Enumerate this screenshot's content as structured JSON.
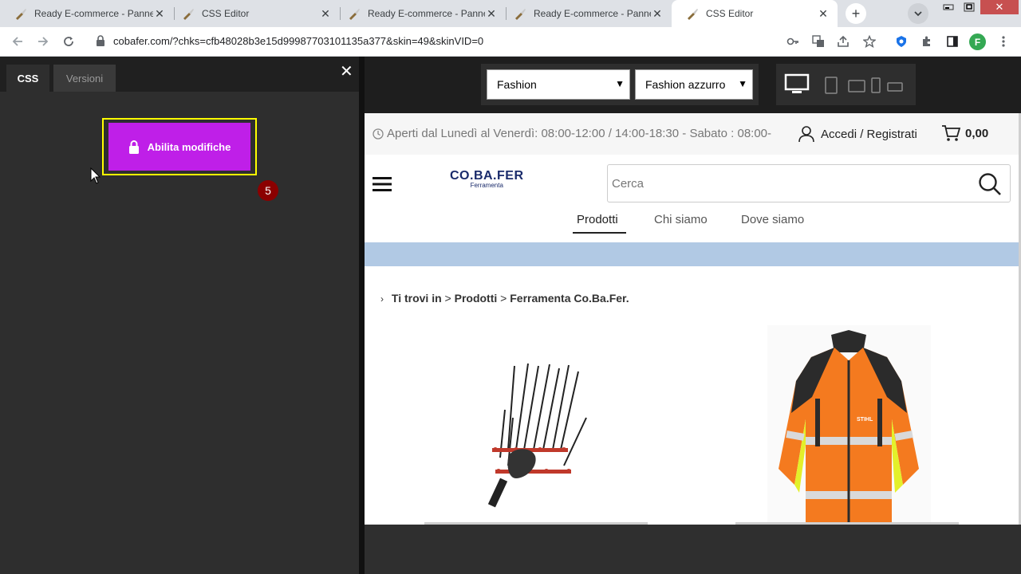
{
  "browser": {
    "tabs": [
      {
        "label": "Ready E-commerce - Pannello",
        "active": false
      },
      {
        "label": "CSS Editor",
        "active": false
      },
      {
        "label": "Ready E-commerce - Pannello",
        "active": false
      },
      {
        "label": "Ready E-commerce - Pannello",
        "active": false
      },
      {
        "label": "CSS Editor",
        "active": true
      }
    ],
    "url": "cobafer.com/?chks=cfb48028b3e15d99987703101135a377&skin=49&skinVID=0",
    "profile_initial": "F"
  },
  "css_panel": {
    "tab_css": "CSS",
    "tab_versions": "Versioni",
    "enable_button": "Abilita modifiche",
    "step_badge": "5",
    "accent_color": "#bf1fe8",
    "highlight_color": "#ffff00"
  },
  "preview_toolbar": {
    "theme_select": "Fashion",
    "color_select": "Fashion azzurro"
  },
  "site": {
    "hours": "Aperti dal Lunedì al Venerdì: 08:00-12:00 / 14:00-18:30 - Sabato : 08:00-",
    "login": "Accedi / Registrati",
    "cart_total": "0,00",
    "logo_main": "CO.BA.FER",
    "logo_sub": "Ferramenta",
    "search_placeholder": "Cerca",
    "menu": [
      "Prodotti",
      "Chi siamo",
      "Dove siamo"
    ],
    "breadcrumb": {
      "intro": "Ti trovi in",
      "sep": ">",
      "level1": "Prodotti",
      "level2": "Ferramenta Co.Ba.Fer."
    },
    "jacket_brand": "STIHL"
  }
}
